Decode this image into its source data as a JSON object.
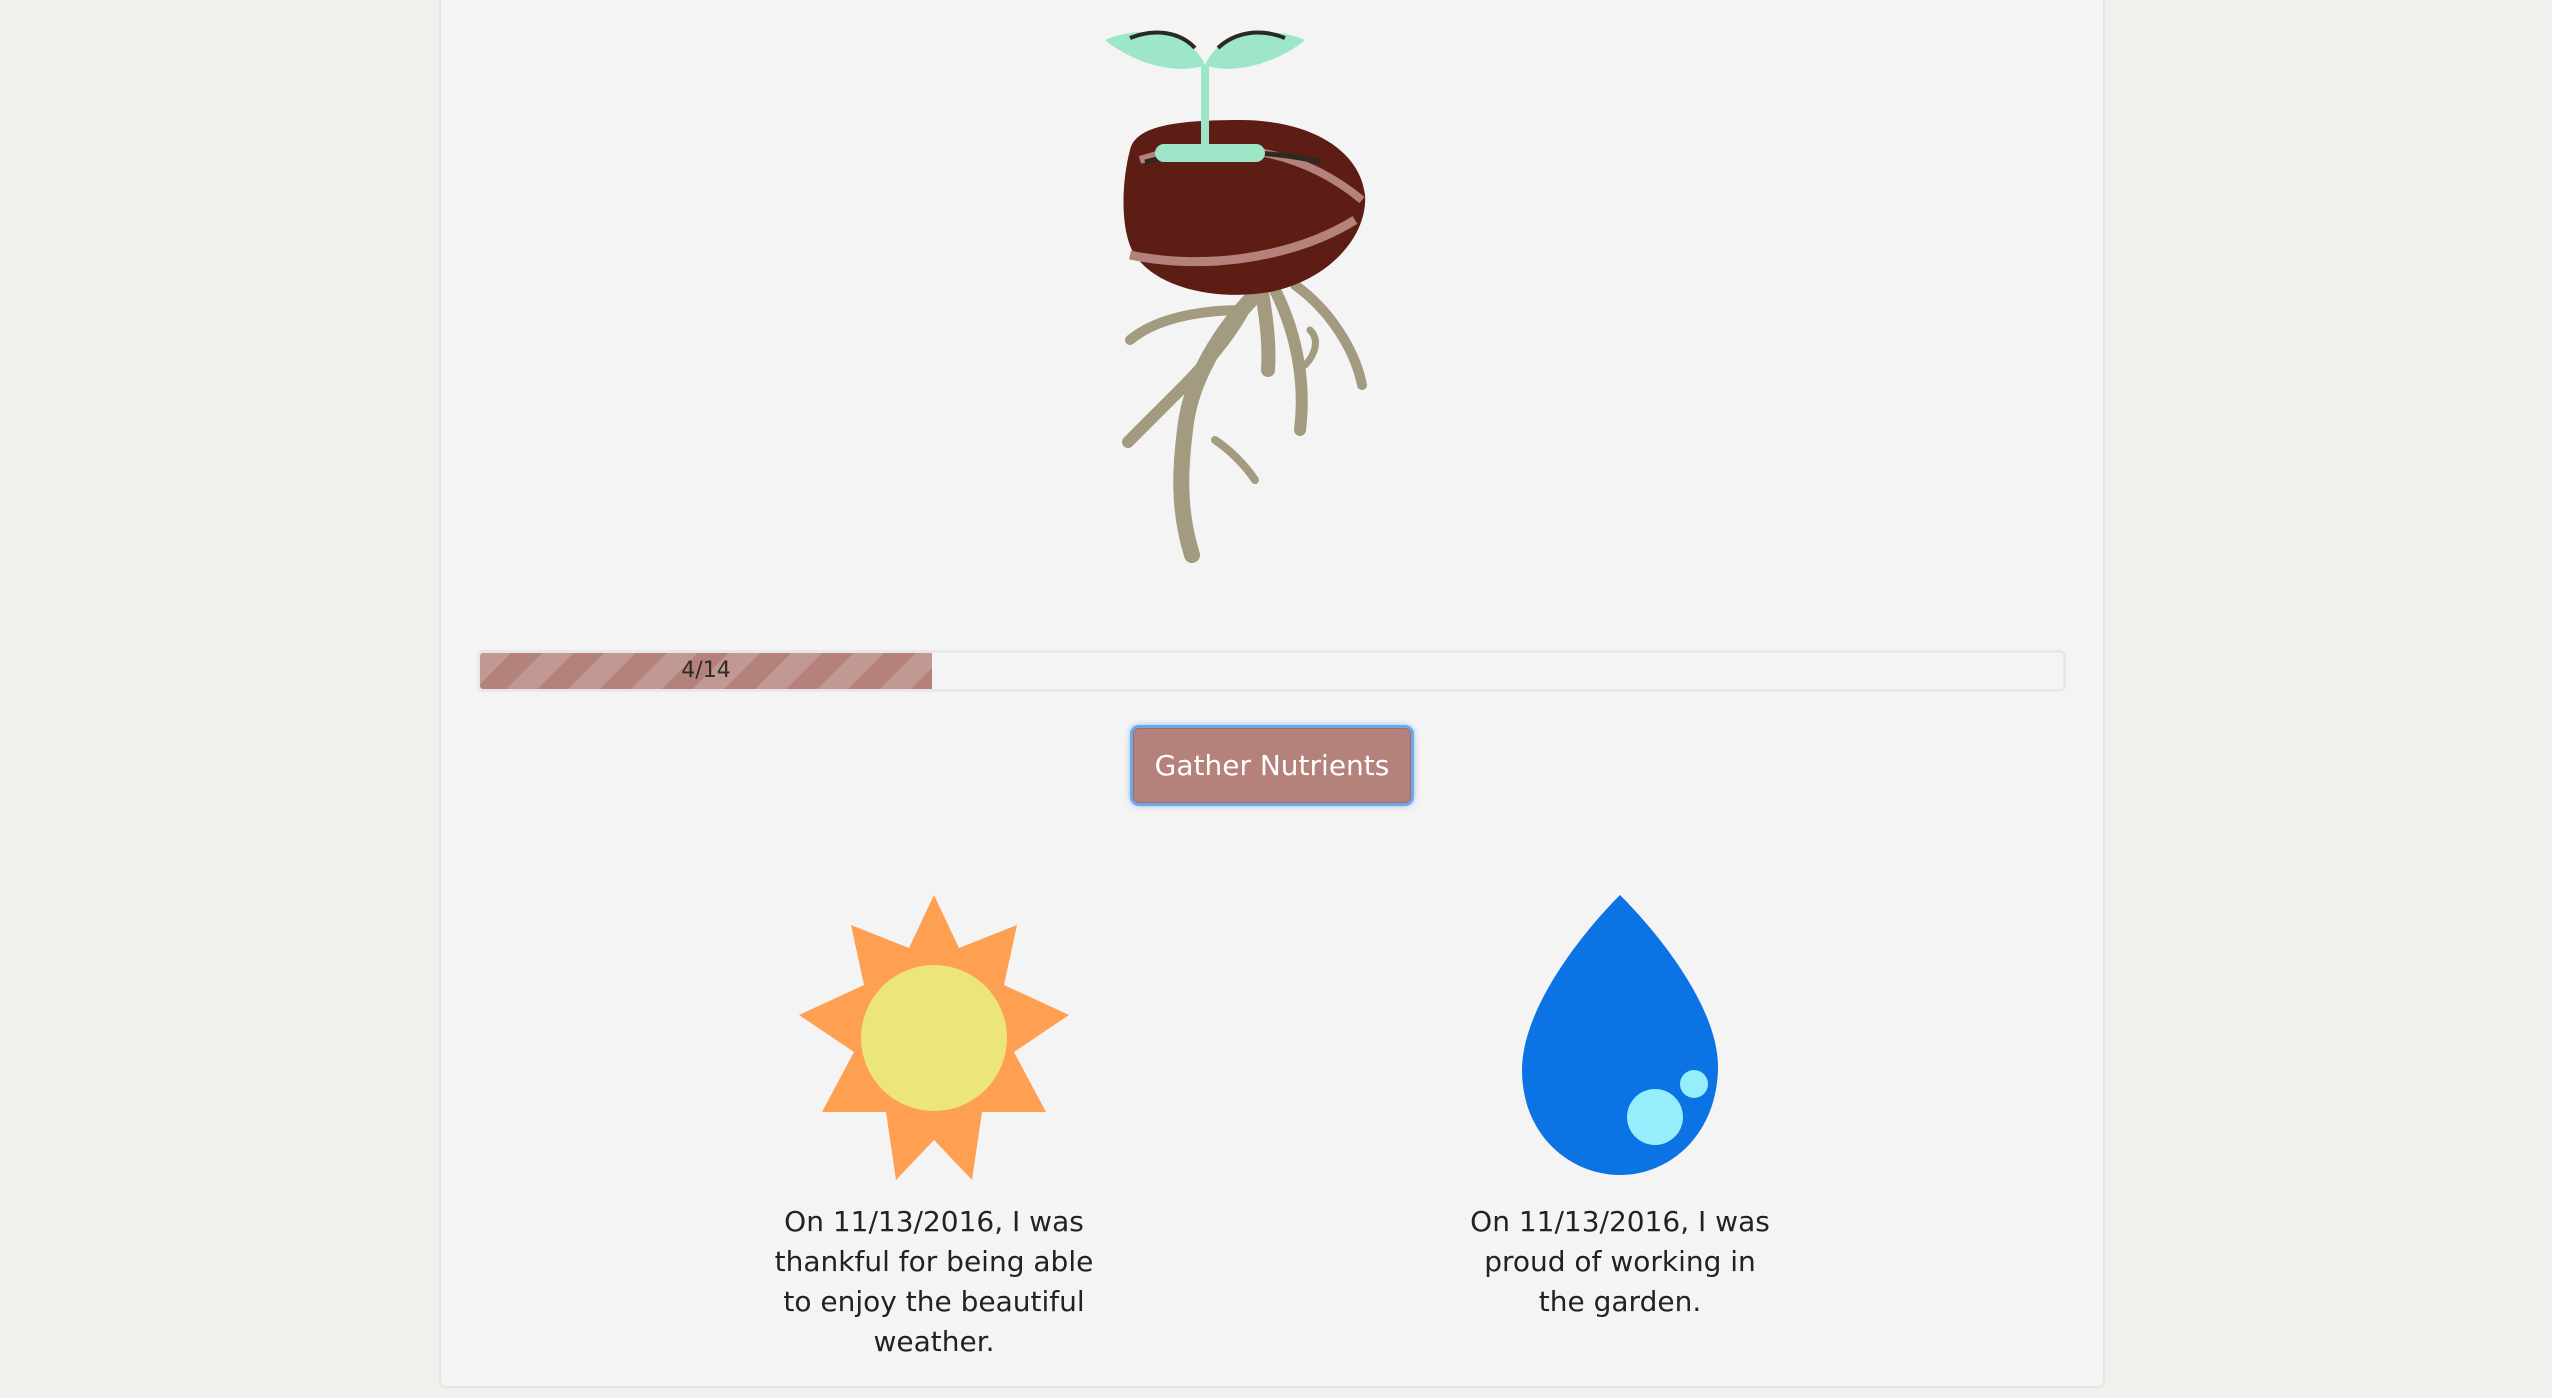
{
  "plant": {
    "stage_name": "seed-sprout",
    "colors": {
      "seed": "#5d1c14",
      "seed_stripe": "#b5817b",
      "sprout": "#9de6c8",
      "roots": "#a39b80"
    }
  },
  "progress": {
    "current": 4,
    "total": 14,
    "label": "4/14",
    "fraction": 0.2857,
    "fill_color": "#b5817b"
  },
  "actions": {
    "gather_label": "Gather Nutrients"
  },
  "rewards": [
    {
      "icon": "sun-icon",
      "text": "On 11/13/2016, I was thankful for being able to enjoy the beautiful weather.",
      "colors": {
        "rays": "#fe9f52",
        "center": "#ebe57a"
      }
    },
    {
      "icon": "water-drop-icon",
      "text": "On 11/13/2016, I was proud of working in the garden.",
      "colors": {
        "drop": "#0c73e4",
        "bubbles": "#96eefc"
      }
    }
  ]
}
